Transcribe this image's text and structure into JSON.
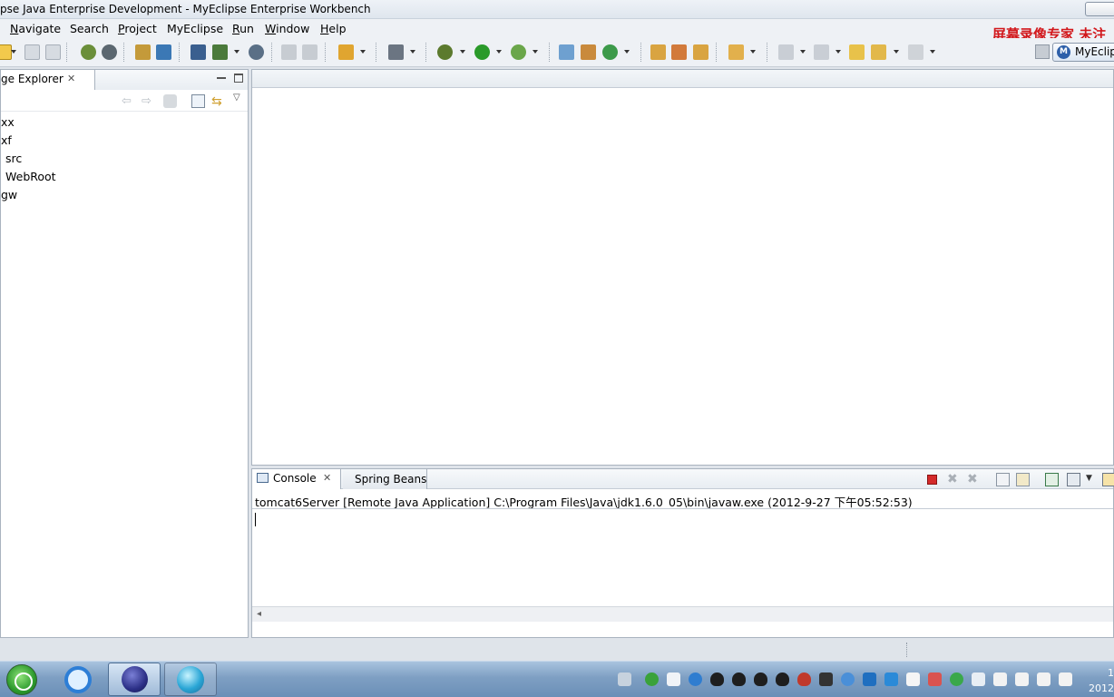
{
  "window": {
    "title": "pse Java Enterprise Development - MyEclipse Enterprise Workbench"
  },
  "menu": [
    {
      "label": "Navigate",
      "mnemonic": "N",
      "rest": "avigate"
    },
    {
      "label": "Search",
      "mnemonic": "",
      "rest": "Search"
    },
    {
      "label": "Project",
      "mnemonic": "P",
      "rest": "roject"
    },
    {
      "label": "MyEclipse",
      "mnemonic": "",
      "rest": "MyEclipse"
    },
    {
      "label": "Run",
      "mnemonic": "R",
      "rest": "un"
    },
    {
      "label": "Window",
      "mnemonic": "W",
      "rest": "indow"
    },
    {
      "label": "Help",
      "mnemonic": "H",
      "rest": "elp"
    }
  ],
  "watermark": "屏幕录像专家  未注",
  "perspective": {
    "label": "MyEclip"
  },
  "explorer": {
    "tab_label": "ge Explorer",
    "tree": [
      {
        "label": "xx",
        "indent": 0
      },
      {
        "label": "xf",
        "indent": 0
      },
      {
        "label": "src",
        "indent": 1
      },
      {
        "label": "WebRoot",
        "indent": 1
      },
      {
        "label": "gw",
        "indent": 0
      }
    ]
  },
  "console": {
    "tabs": [
      "Console",
      "Spring Beans"
    ],
    "description": "tomcat6Server [Remote Java Application] C:\\Program Files\\Java\\jdk1.6.0_05\\bin\\javaw.exe (2012-9-27 下午05:52:53)"
  },
  "clock": {
    "time": "1",
    "date": "2012"
  },
  "colors": {
    "terminate": "#d42a2a",
    "run": "#2a9a2a",
    "accent": "#2d5fa9"
  }
}
